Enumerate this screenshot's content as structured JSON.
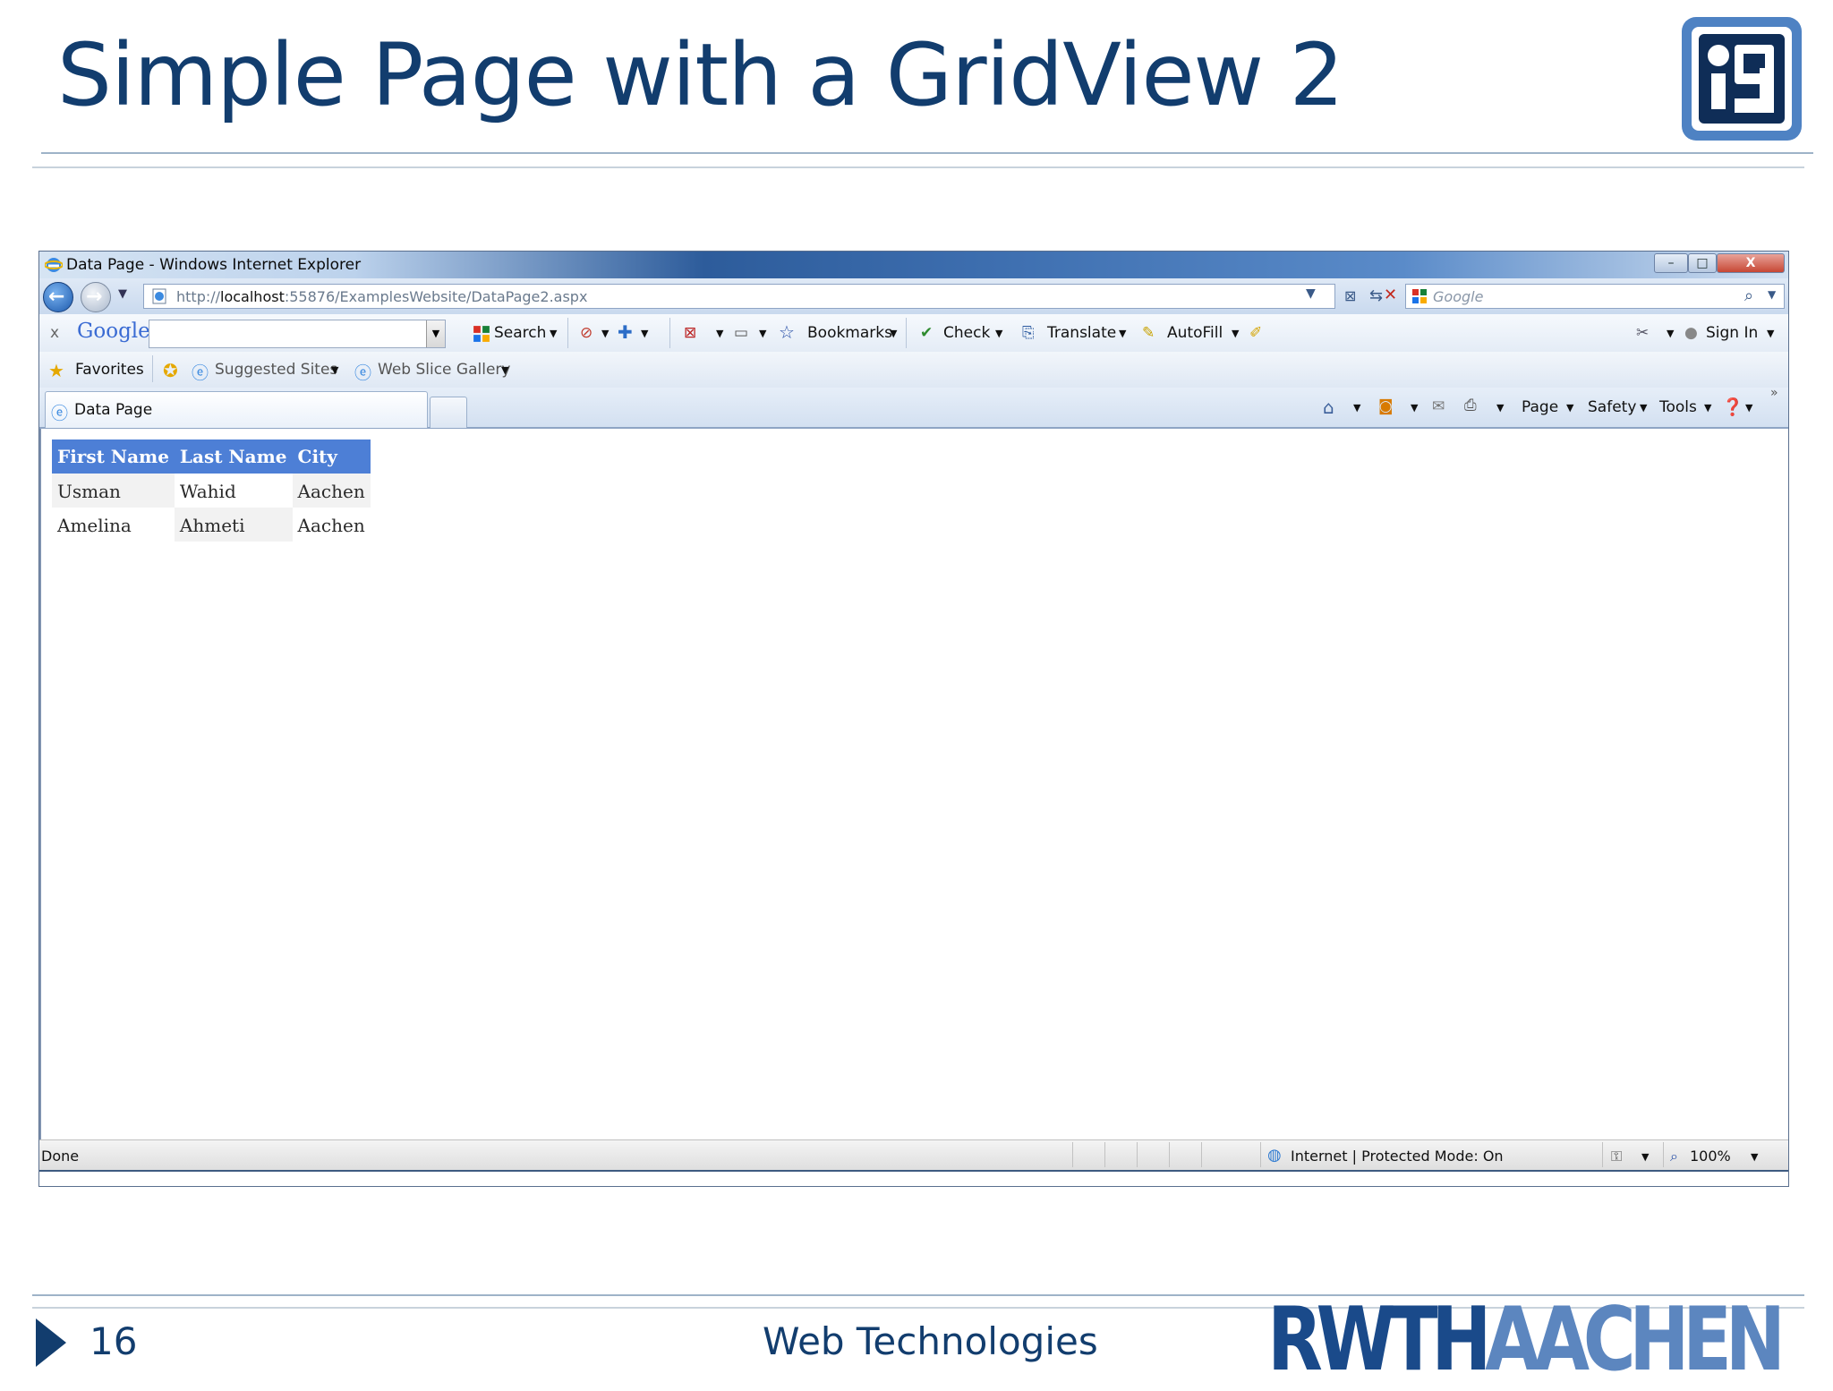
{
  "slide": {
    "title": "Simple Page with a GridView 2",
    "page_number": "16",
    "footer_title": "Web Technologies",
    "logo_rwth_part1": "RWTH",
    "logo_rwth_part2": "AACHEN",
    "logo_i9": "i9"
  },
  "browser": {
    "window_title": "Data Page - Windows Internet Explorer",
    "window_buttons": {
      "minimize": "–",
      "maximize": "□",
      "close": "X"
    },
    "address": {
      "url_prefix": "http://",
      "url_host": "localhost",
      "url_rest": ":55876/ExamplesWebsite/DataPage2.aspx",
      "search_placeholder": "Google"
    },
    "google_toolbar": {
      "close": "x",
      "logo": "Google",
      "search": "Search",
      "bookmarks": "Bookmarks",
      "check": "Check",
      "translate": "Translate",
      "autofill": "AutoFill",
      "sign_in": "Sign In"
    },
    "favorites_bar": {
      "favorites": "Favorites",
      "suggested_sites": "Suggested Sites",
      "web_slice_gallery": "Web Slice Gallery"
    },
    "tab": {
      "label": "Data Page"
    },
    "command_bar": {
      "page": "Page",
      "safety": "Safety",
      "tools": "Tools",
      "chevron": "»"
    },
    "gridview": {
      "headers": [
        "First Name",
        "Last Name",
        "City"
      ],
      "rows": [
        [
          "Usman",
          "Wahid",
          "Aachen"
        ],
        [
          "Amelina",
          "Ahmeti",
          "Aachen"
        ]
      ]
    },
    "status": {
      "left": "Done",
      "zone": "Internet | Protected Mode: On",
      "zoom": "100%"
    }
  },
  "colors": {
    "slide_title": "#123d6e",
    "grid_header": "#4d7fd6",
    "rwth_dark": "#1a4a8a",
    "rwth_light": "#5c86bf"
  }
}
